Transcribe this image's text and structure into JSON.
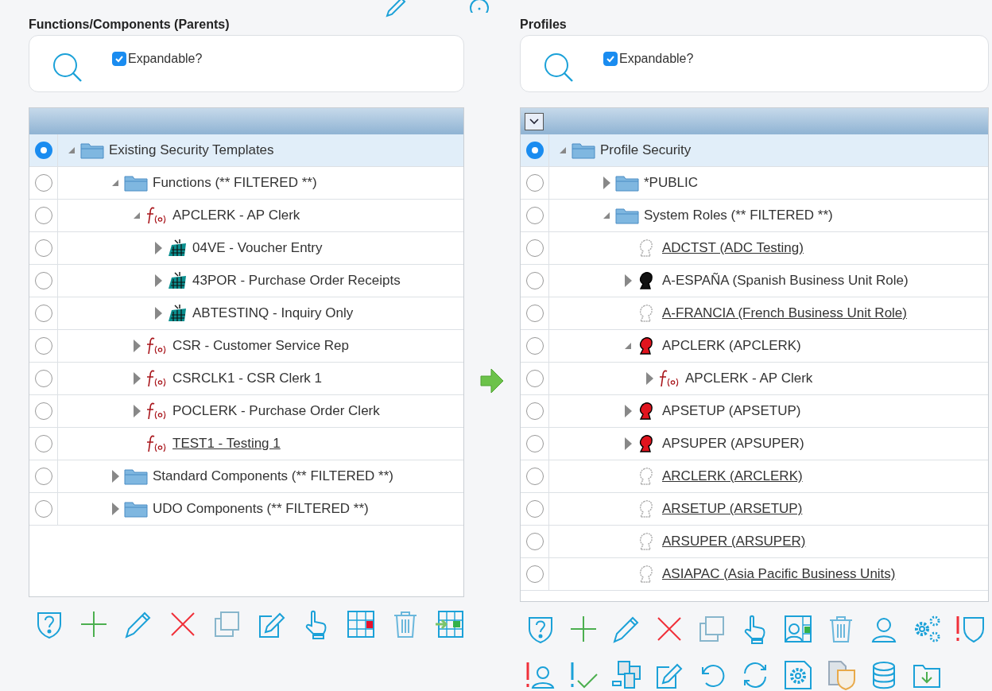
{
  "left_panel": {
    "title": "Functions/Components (Parents)",
    "expandable": {
      "label": "Expandable?",
      "checked": true
    },
    "tree": [
      {
        "label": "Existing Security Templates",
        "kind": "folder",
        "expanded": true,
        "linked": false,
        "selected": true,
        "children": [
          {
            "label": "Functions (** FILTERED **)",
            "kind": "folder",
            "expanded": true,
            "linked": false,
            "selected": false,
            "children": [
              {
                "label": "APCLERK - AP Clerk",
                "kind": "function",
                "expanded": true,
                "linked": false,
                "selected": false,
                "children": [
                  {
                    "label": "04VE - Voucher Entry",
                    "kind": "application",
                    "expanded": false,
                    "linked": false,
                    "selected": false
                  },
                  {
                    "label": "43POR - Purchase Order Receipts",
                    "kind": "application",
                    "expanded": false,
                    "linked": false,
                    "selected": false
                  },
                  {
                    "label": "ABTESTINQ - Inquiry Only",
                    "kind": "application",
                    "expanded": false,
                    "linked": false,
                    "selected": false
                  }
                ]
              },
              {
                "label": "CSR - Customer Service Rep",
                "kind": "function",
                "expanded": false,
                "linked": false,
                "selected": false
              },
              {
                "label": "CSRCLK1 - CSR Clerk 1",
                "kind": "function",
                "expanded": false,
                "linked": false,
                "selected": false
              },
              {
                "label": "POCLERK - Purchase Order Clerk",
                "kind": "function",
                "expanded": false,
                "linked": false,
                "selected": false
              },
              {
                "label": "TEST1 - Testing 1",
                "kind": "function",
                "linked": true,
                "selected": false
              }
            ]
          },
          {
            "label": "Standard Components (** FILTERED **)",
            "kind": "folder",
            "expanded": false,
            "linked": false,
            "selected": false
          },
          {
            "label": "UDO Components (** FILTERED **)",
            "kind": "folder",
            "expanded": false,
            "linked": false,
            "selected": false
          }
        ]
      }
    ]
  },
  "right_panel": {
    "title": "Profiles",
    "expandable": {
      "label": "Expandable?",
      "checked": true
    },
    "tree": [
      {
        "label": "Profile Security",
        "kind": "folder",
        "expanded": true,
        "linked": false,
        "selected": true,
        "children": [
          {
            "label": "*PUBLIC",
            "kind": "folder",
            "expanded": false,
            "linked": false,
            "selected": false
          },
          {
            "label": "System Roles (** FILTERED **)",
            "kind": "folder",
            "expanded": true,
            "linked": false,
            "selected": false,
            "children": [
              {
                "label": "ADCTST (ADC Testing)",
                "kind": "role_unassigned",
                "linked": true,
                "selected": false
              },
              {
                "label": "A-ESPAÑA (Spanish Business Unit Role)",
                "kind": "role",
                "expanded": false,
                "linked": false,
                "selected": false
              },
              {
                "label": "A-FRANCIA (French Business Unit Role)",
                "kind": "role_unassigned",
                "linked": true,
                "selected": false
              },
              {
                "label": "APCLERK (APCLERK)",
                "kind": "role_assigned",
                "expanded": true,
                "linked": false,
                "selected": false,
                "children": [
                  {
                    "label": "APCLERK - AP Clerk",
                    "kind": "function",
                    "expanded": false,
                    "linked": false,
                    "selected": false
                  }
                ]
              },
              {
                "label": "APSETUP (APSETUP)",
                "kind": "role_assigned",
                "expanded": false,
                "linked": false,
                "selected": false
              },
              {
                "label": "APSUPER (APSUPER)",
                "kind": "role_assigned",
                "expanded": false,
                "linked": false,
                "selected": false
              },
              {
                "label": "ARCLERK (ARCLERK)",
                "kind": "role_unassigned",
                "linked": true,
                "selected": false
              },
              {
                "label": "ARSETUP (ARSETUP)",
                "kind": "role_unassigned",
                "linked": true,
                "selected": false
              },
              {
                "label": "ARSUPER (ARSUPER)",
                "kind": "role_unassigned",
                "linked": true,
                "selected": false
              },
              {
                "label": "ASIAPAC (Asia Pacific Business Units)",
                "kind": "role_unassigned",
                "linked": true,
                "selected": false
              }
            ]
          }
        ]
      }
    ]
  }
}
